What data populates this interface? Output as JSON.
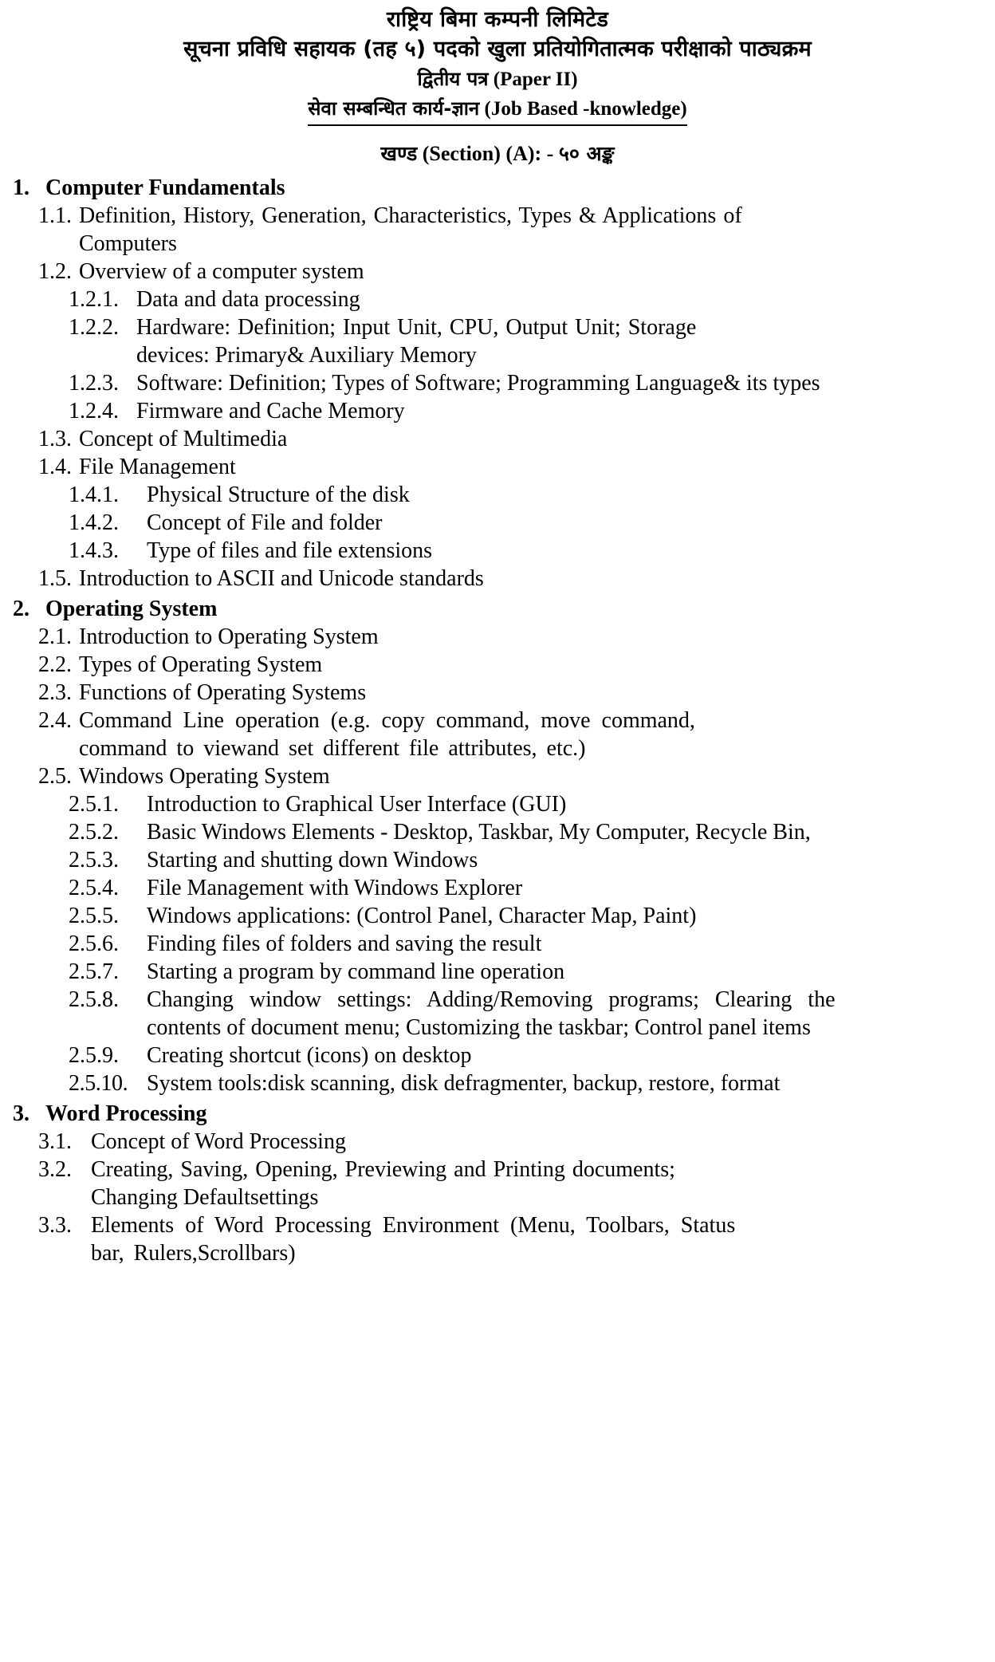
{
  "header": {
    "org_name": "राष्ट्रिय बिमा कम्पनी लिमिटेड",
    "exam_title": "सूचना प्रविधि सहायक (तह ५) पदको खुला प्रतियोगितात्मक परीक्षाको पाठ्यक्रम",
    "paper_np": "द्वितीय पत्र",
    "paper_en": "(Paper II)",
    "subject_np": "सेवा सम्बन्धित कार्य-ज्ञान",
    "subject_en": "(Job Based -knowledge)",
    "section_np_khanda": "खण्ड",
    "section_en": "(Section) (A): -",
    "section_marks_np": "५० अङ्क"
  },
  "outline": {
    "s1": {
      "num": "1.",
      "title": "Computer Fundamentals",
      "i1": {
        "num": "1.1.",
        "line1": "Definition, History, Generation, Characteristics, Types & Applications of",
        "line2": "Computers"
      },
      "i2": {
        "num": "1.2.",
        "text": "Overview of a computer system"
      },
      "i2_1": {
        "num": "1.2.1.",
        "text": "Data and data processing"
      },
      "i2_2": {
        "num": "1.2.2.",
        "line1": "Hardware: Definition; Input Unit, CPU, Output Unit; Storage",
        "line2": "devices: Primary& Auxiliary Memory"
      },
      "i2_3": {
        "num": "1.2.3.",
        "text": "Software: Definition; Types of Software; Programming Language& its types"
      },
      "i2_4": {
        "num": "1.2.4.",
        "text": "Firmware and Cache Memory"
      },
      "i3": {
        "num": "1.3.",
        "text": "Concept of Multimedia"
      },
      "i4": {
        "num": "1.4.",
        "text": "File Management"
      },
      "i4_1": {
        "num": "1.4.1.",
        "text": "Physical Structure of the disk"
      },
      "i4_2": {
        "num": "1.4.2.",
        "text": "Concept of File and folder"
      },
      "i4_3": {
        "num": "1.4.3.",
        "text": "Type of files and file extensions"
      },
      "i5": {
        "num": "1.5.",
        "text": "Introduction to ASCII and Unicode standards"
      }
    },
    "s2": {
      "num": "2.",
      "title": "Operating System",
      "i1": {
        "num": "2.1.",
        "text": "Introduction to Operating System"
      },
      "i2": {
        "num": "2.2.",
        "text": "Types of Operating System"
      },
      "i3": {
        "num": "2.3.",
        "text": "Functions of Operating Systems"
      },
      "i4": {
        "num": "2.4.",
        "line1": "Command Line operation (e.g. copy command, move command,",
        "line2": "command to viewand set different file attributes, etc.)"
      },
      "i5": {
        "num": "2.5.",
        "text": "Windows Operating System"
      },
      "i5_1": {
        "num": "2.5.1.",
        "text": "Introduction to Graphical User Interface (GUI)"
      },
      "i5_2": {
        "num": "2.5.2.",
        "text": "Basic Windows Elements - Desktop, Taskbar, My Computer, Recycle Bin,"
      },
      "i5_3": {
        "num": "2.5.3.",
        "text": "Starting and shutting down Windows"
      },
      "i5_4": {
        "num": "2.5.4.",
        "text": "File Management with Windows Explorer"
      },
      "i5_5": {
        "num": "2.5.5.",
        "text": "Windows applications: (Control Panel, Character Map, Paint)"
      },
      "i5_6": {
        "num": "2.5.6.",
        "text": "Finding files of folders and saving the result"
      },
      "i5_7": {
        "num": "2.5.7.",
        "text": "Starting a program by command line operation"
      },
      "i5_8": {
        "num": "2.5.8.",
        "line1": "Changing window settings: Adding/Removing programs; Clearing the",
        "line2": "contents of document menu; Customizing the taskbar; Control panel items"
      },
      "i5_9": {
        "num": "2.5.9.",
        "text": "Creating shortcut (icons) on desktop"
      },
      "i5_10": {
        "num": "2.5.10.",
        "text": "System tools:disk scanning, disk defragmenter, backup, restore, format"
      }
    },
    "s3": {
      "num": "3.",
      "title": "Word Processing",
      "i1": {
        "num": "3.1.",
        "text": "Concept of Word Processing"
      },
      "i2": {
        "num": "3.2.",
        "line1": "Creating, Saving, Opening, Previewing and Printing documents;",
        "line2": "Changing Defaultsettings"
      },
      "i3": {
        "num": "3.3.",
        "line1": "Elements of Word Processing Environment (Menu, Toolbars, Status",
        "line2": "bar, Rulers,Scrollbars)"
      }
    }
  }
}
